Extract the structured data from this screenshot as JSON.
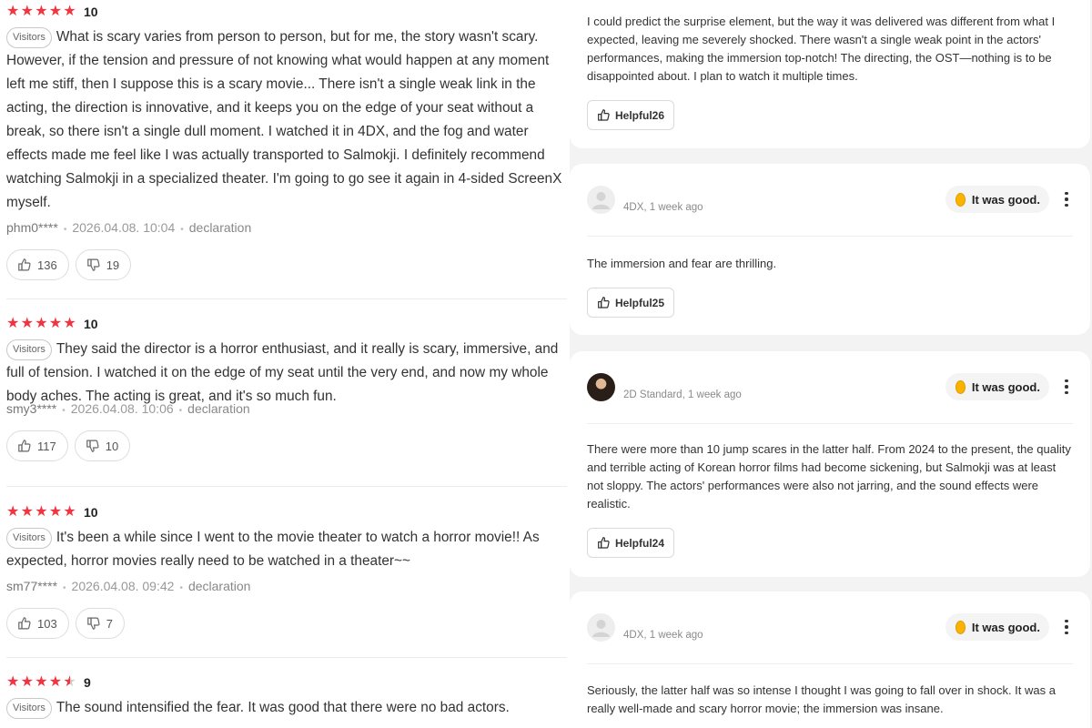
{
  "left_reviews": [
    {
      "stars": "5",
      "score": "10",
      "badge": "Visitors",
      "text": "What is scary varies from person to person, but for me, the story wasn't scary. However, if the tension and pressure of not knowing what would happen at any moment left me stiff, then I suppose this is a scary movie... There isn't a single weak link in the acting, the direction is innovative, and it keeps you on the edge of your seat without a break, so there isn't a single dull moment. I watched it in 4DX, and the fog and water effects made me feel like I was actually transported to Salmokji. I definitely recommend watching Salmokji in a specialized theater. I'm going to go see it again in 4-sided ScreenX myself.",
      "user": "phm0****",
      "date": "2026.04.08. 10:04",
      "declaration": "declaration",
      "likes": "136",
      "dislikes": "19"
    },
    {
      "stars": "5",
      "score": "10",
      "badge": "Visitors",
      "text": "They said the director is a horror enthusiast, and it really is scary, immersive, and full of tension. I watched it on the edge of my seat until the very end, and now my whole body aches. The acting is great, and it's so much fun.",
      "user": "smy3****",
      "date": "2026.04.08. 10:06",
      "declaration": "declaration",
      "likes": "117",
      "dislikes": "10"
    },
    {
      "stars": "5",
      "score": "10",
      "badge": "Visitors",
      "text": "It's been a while since I went to the movie theater to watch a horror movie!! As expected, horror movies really need to be watched in a theater~~",
      "user": "sm77****",
      "date": "2026.04.08. 09:42",
      "declaration": "declaration",
      "likes": "103",
      "dislikes": "7"
    },
    {
      "stars": "4.5",
      "score": "9",
      "badge": "Visitors",
      "text": "The sound intensified the fear. It was good that there were no bad actors."
    }
  ],
  "right_cards": [
    {
      "text": "I could predict the surprise element, but the way it was delivered was different from what I expected, leaving me severely shocked. There wasn't a single weak point in the actors' performances, making the immersion top-notch! The directing, the OST—nothing is to be disappointed about. I plan to watch it multiple times.",
      "helpful": "Helpful26"
    },
    {
      "meta": "4DX, 1 week ago",
      "rating": "It was good.",
      "text": "The immersion and fear are thrilling.",
      "helpful": "Helpful25"
    },
    {
      "meta": "2D Standard, 1 week ago",
      "rating": "It was good.",
      "text": "There were more than 10 jump scares in the latter half. From 2024 to the present, the quality and terrible acting of Korean horror films had become sickening, but Salmokji was at least not sloppy. The actors' performances were also not jarring, and the sound effects were realistic.",
      "helpful": "Helpful24"
    },
    {
      "meta": "4DX, 1 week ago",
      "rating": "It was good.",
      "text": "Seriously, the latter half was so intense I thought I was going to fall over in shock. It was a really well-made and scary horror movie; the immersion was insane."
    }
  ],
  "colors": {
    "star": "#f1343f",
    "bean": "#f9b300",
    "right_bg": "#f3f3f3"
  },
  "icons": [
    "star-icon",
    "thumbs-up-icon",
    "thumbs-down-icon",
    "popcorn-bean-icon",
    "more-options-icon",
    "default-avatar-icon"
  ]
}
